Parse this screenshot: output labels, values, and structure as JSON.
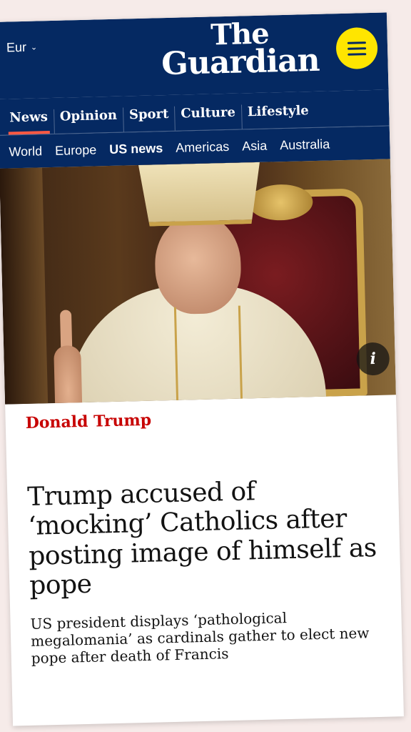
{
  "masthead": {
    "edition_label": "Eur",
    "logo_line1": "The",
    "logo_line2": "Guardian",
    "menu_icon": "hamburger-menu-icon",
    "brand_color": "#052962",
    "menu_color": "#ffe500"
  },
  "pillars": [
    {
      "label": "News",
      "active": true
    },
    {
      "label": "Opinion"
    },
    {
      "label": "Sport"
    },
    {
      "label": "Culture"
    },
    {
      "label": "Lifestyle"
    }
  ],
  "subnav": [
    {
      "label": "World"
    },
    {
      "label": "Europe"
    },
    {
      "label": "US news",
      "active": true
    },
    {
      "label": "Americas"
    },
    {
      "label": "Asia"
    },
    {
      "label": "Australia"
    }
  ],
  "hero": {
    "info_icon": "info-icon",
    "info_label": "i"
  },
  "article": {
    "kicker": "Donald Trump",
    "kicker_color": "#c70000",
    "headline": "Trump accused of ‘mocking’ Catholics after posting image of himself as pope",
    "standfirst": "US president displays ‘pathological megalomania’ as cardinals gather to elect new pope after death of Francis"
  }
}
